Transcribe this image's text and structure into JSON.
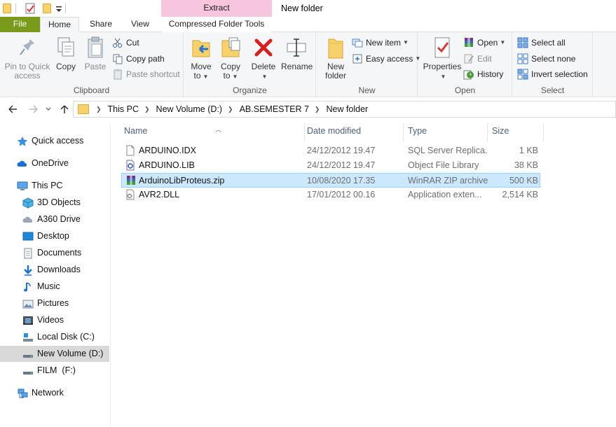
{
  "window": {
    "title": "New folder",
    "context_tab_header": "Extract"
  },
  "tabs": {
    "file": "File",
    "home": "Home",
    "share": "Share",
    "view": "View",
    "compressed": "Compressed Folder Tools"
  },
  "ribbon": {
    "clipboard": {
      "label": "Clipboard",
      "pin_line1": "Pin to Quick",
      "pin_line2": "access",
      "copy": "Copy",
      "paste": "Paste",
      "cut": "Cut",
      "copy_path": "Copy path",
      "paste_shortcut": "Paste shortcut"
    },
    "organize": {
      "label": "Organize",
      "move_line1": "Move",
      "move_line2": "to",
      "copy_line1": "Copy",
      "copy_line2": "to",
      "delete": "Delete",
      "rename": "Rename"
    },
    "new": {
      "label": "New",
      "new_folder_line1": "New",
      "new_folder_line2": "folder",
      "new_item": "New item",
      "easy_access": "Easy access"
    },
    "open": {
      "label": "Open",
      "properties": "Properties",
      "open": "Open",
      "edit": "Edit",
      "history": "History"
    },
    "select": {
      "label": "Select",
      "select_all": "Select all",
      "select_none": "Select none",
      "invert": "Invert selection"
    }
  },
  "address": {
    "crumbs": [
      "This PC",
      "New Volume (D:)",
      "AB.SEMESTER 7",
      "New folder"
    ]
  },
  "navpane": {
    "items": [
      "Quick access",
      "OneDrive",
      "This PC",
      "3D Objects",
      "A360 Drive",
      "Desktop",
      "Documents",
      "Downloads",
      "Music",
      "Pictures",
      "Videos",
      "Local Disk (C:)",
      "New Volume (D:)",
      "FILM  (F:)",
      "Network"
    ]
  },
  "filelist": {
    "columns": [
      "Name",
      "Date modified",
      "Type",
      "Size"
    ],
    "rows": [
      {
        "name": "ARDUINO.IDX",
        "date": "24/12/2012 19.47",
        "type": "SQL Server Replica...",
        "size": "1 KB"
      },
      {
        "name": "ARDUINO.LIB",
        "date": "24/12/2012 19.47",
        "type": "Object File Library",
        "size": "38 KB"
      },
      {
        "name": "ArduinoLibProteus.zip",
        "date": "10/08/2020 17.35",
        "type": "WinRAR ZIP archive",
        "size": "500 KB"
      },
      {
        "name": "AVR2.DLL",
        "date": "17/01/2012 00.16",
        "type": "Application exten...",
        "size": "2,514 KB"
      }
    ]
  },
  "colors": {
    "file_tab": "#7a9a1c",
    "context_header": "#f7c5dd",
    "selection": "#cce8ff",
    "selection_border": "#99d1ff"
  }
}
